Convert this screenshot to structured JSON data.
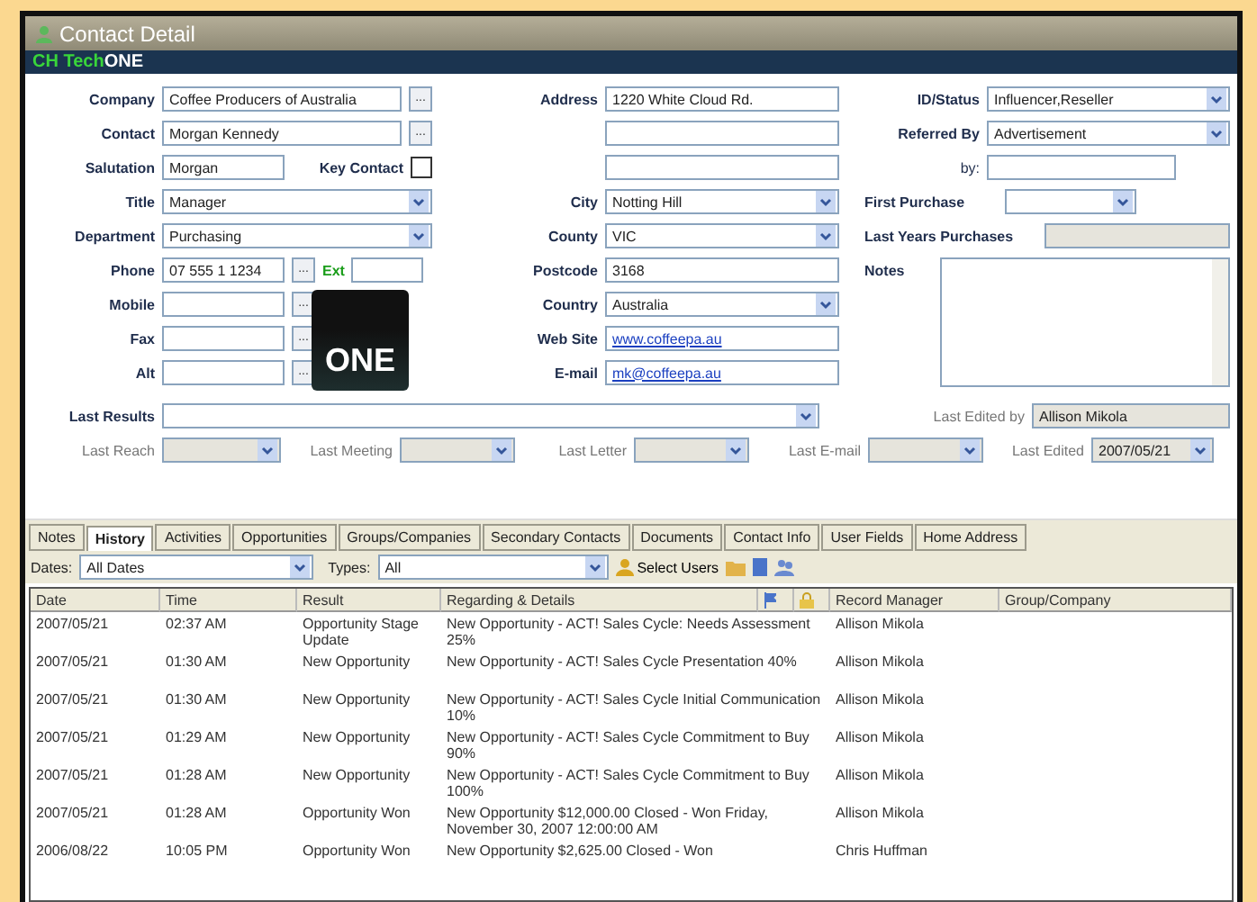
{
  "window": {
    "title": "Contact Detail"
  },
  "brand": {
    "part_1": "CH Tech",
    "part_2": "ONE"
  },
  "left": {
    "rows": [
      {
        "label": "Company",
        "kind": "input",
        "value": "Coffee Producers of Australia",
        "browse": "..."
      },
      {
        "label": "Contact",
        "kind": "input",
        "value": "Morgan Kennedy",
        "browse": "..."
      },
      {
        "label": "Salutation",
        "kind": "short",
        "value": "Morgan",
        "key_contact": {
          "label": "Key Contact",
          "checked": false
        }
      },
      {
        "label": "Title",
        "kind": "select",
        "value": "Manager"
      },
      {
        "label": "Department",
        "kind": "select",
        "value": "Purchasing"
      },
      {
        "label": "Phone",
        "kind": "short",
        "value": "07 555 1 1234",
        "browse": "...",
        "ext": {
          "label": "Ext"
        }
      }
    ],
    "side_rows": [
      {
        "label": "Mobile",
        "kind": "short",
        "browse": "..."
      },
      {
        "label": "Fax",
        "kind": "short",
        "browse": "..."
      },
      {
        "label": "Alt",
        "kind": "short",
        "browse": "..."
      }
    ],
    "logo": {
      "text": "ONE"
    }
  },
  "middle": {
    "rows": [
      {
        "label": "Address",
        "kind": "input",
        "value": "1220 White Cloud Rd."
      },
      {
        "kind": "input"
      },
      {
        "kind": "input"
      },
      {
        "label": "City",
        "kind": "select",
        "value": "Notting Hill"
      },
      {
        "label": "County",
        "kind": "select",
        "value": "VIC"
      },
      {
        "label": "Postcode",
        "kind": "input",
        "value": "3168"
      },
      {
        "label": "Country",
        "kind": "select",
        "value": "Australia"
      },
      {
        "label": "Web Site",
        "kind": "link",
        "value": "www.coffeepa.au"
      },
      {
        "label": "E-mail",
        "kind": "link",
        "value": "mk@coffeepa.au"
      }
    ]
  },
  "right": {
    "rows": [
      {
        "label": "ID/Status",
        "kind": "select",
        "value": "Influencer,Reseller"
      },
      {
        "label": "Referred By",
        "kind": "select",
        "value": "Advertisement"
      },
      {
        "label": "by:",
        "kind": "by-input"
      },
      {
        "label": "First Purchase",
        "kind": "short-select"
      },
      {
        "label": "Last Years Purchases",
        "kind": "grey-input"
      }
    ],
    "notes": {
      "label": "Notes"
    }
  },
  "last_results": {
    "label": "Last Results",
    "edited_by_label": "Last Edited by",
    "edited_by": "Allison Mikola"
  },
  "last_row": [
    {
      "label": "Last Reach"
    },
    {
      "label": "Last Meeting"
    },
    {
      "label": "Last Letter"
    },
    {
      "label": "Last E-mail"
    },
    {
      "label": "Last Edited",
      "value": "2007/05/21"
    }
  ],
  "tabs": [
    {
      "label": "Notes",
      "selected": false
    },
    {
      "label": "History",
      "selected": true
    },
    {
      "label": "Activities",
      "selected": false
    },
    {
      "label": "Opportunities",
      "selected": false
    },
    {
      "label": "Groups/Companies",
      "selected": false
    },
    {
      "label": "Secondary Contacts",
      "selected": false
    },
    {
      "label": "Documents",
      "selected": false
    },
    {
      "label": "Contact Info",
      "selected": false
    },
    {
      "label": "User Fields",
      "selected": false
    },
    {
      "label": "Home Address",
      "selected": false
    }
  ],
  "filter": {
    "dates_label": "Dates:",
    "dates": "All Dates",
    "types_label": "Types:",
    "types": "All",
    "select_users": "Select Users"
  },
  "table": {
    "columns": [
      {
        "label": "Date"
      },
      {
        "label": "Time"
      },
      {
        "label": "Result"
      },
      {
        "label": "Regarding & Details"
      },
      {
        "kind": "flag"
      },
      {
        "kind": "lock"
      },
      {
        "label": "Record Manager"
      },
      {
        "label": "Group/Company"
      }
    ],
    "rows": [
      [
        "2007/05/21",
        "02:37 AM",
        "Opportunity Stage Update",
        "New Opportunity - ACT! Sales Cycle: Needs Assessment 25%",
        "",
        "",
        "Allison Mikola",
        ""
      ],
      [
        "2007/05/21",
        "01:30 AM",
        "New Opportunity",
        "New Opportunity - ACT! Sales Cycle Presentation 40%",
        "",
        "",
        "Allison Mikola",
        ""
      ],
      [
        "2007/05/21",
        "01:30 AM",
        "New Opportunity",
        "New Opportunity - ACT! Sales Cycle Initial Communication 10%",
        "",
        "",
        "Allison Mikola",
        ""
      ],
      [
        "2007/05/21",
        "01:29 AM",
        "New Opportunity",
        "New Opportunity - ACT! Sales Cycle Commitment to Buy 90%",
        "",
        "",
        "Allison Mikola",
        ""
      ],
      [
        "2007/05/21",
        "01:28 AM",
        "New Opportunity",
        "New Opportunity - ACT! Sales Cycle Commitment to Buy 100%",
        "",
        "",
        "Allison Mikola",
        ""
      ],
      [
        "2007/05/21",
        "01:28 AM",
        "Opportunity Won",
        "New Opportunity $12,000.00 Closed - Won Friday, November 30, 2007 12:00:00 AM",
        "",
        "",
        "Allison Mikola",
        ""
      ],
      [
        "2006/08/22",
        "10:05 PM",
        "Opportunity Won",
        "New Opportunity $2,625.00 Closed - Won",
        "",
        "",
        "Chris Huffman",
        ""
      ]
    ]
  }
}
